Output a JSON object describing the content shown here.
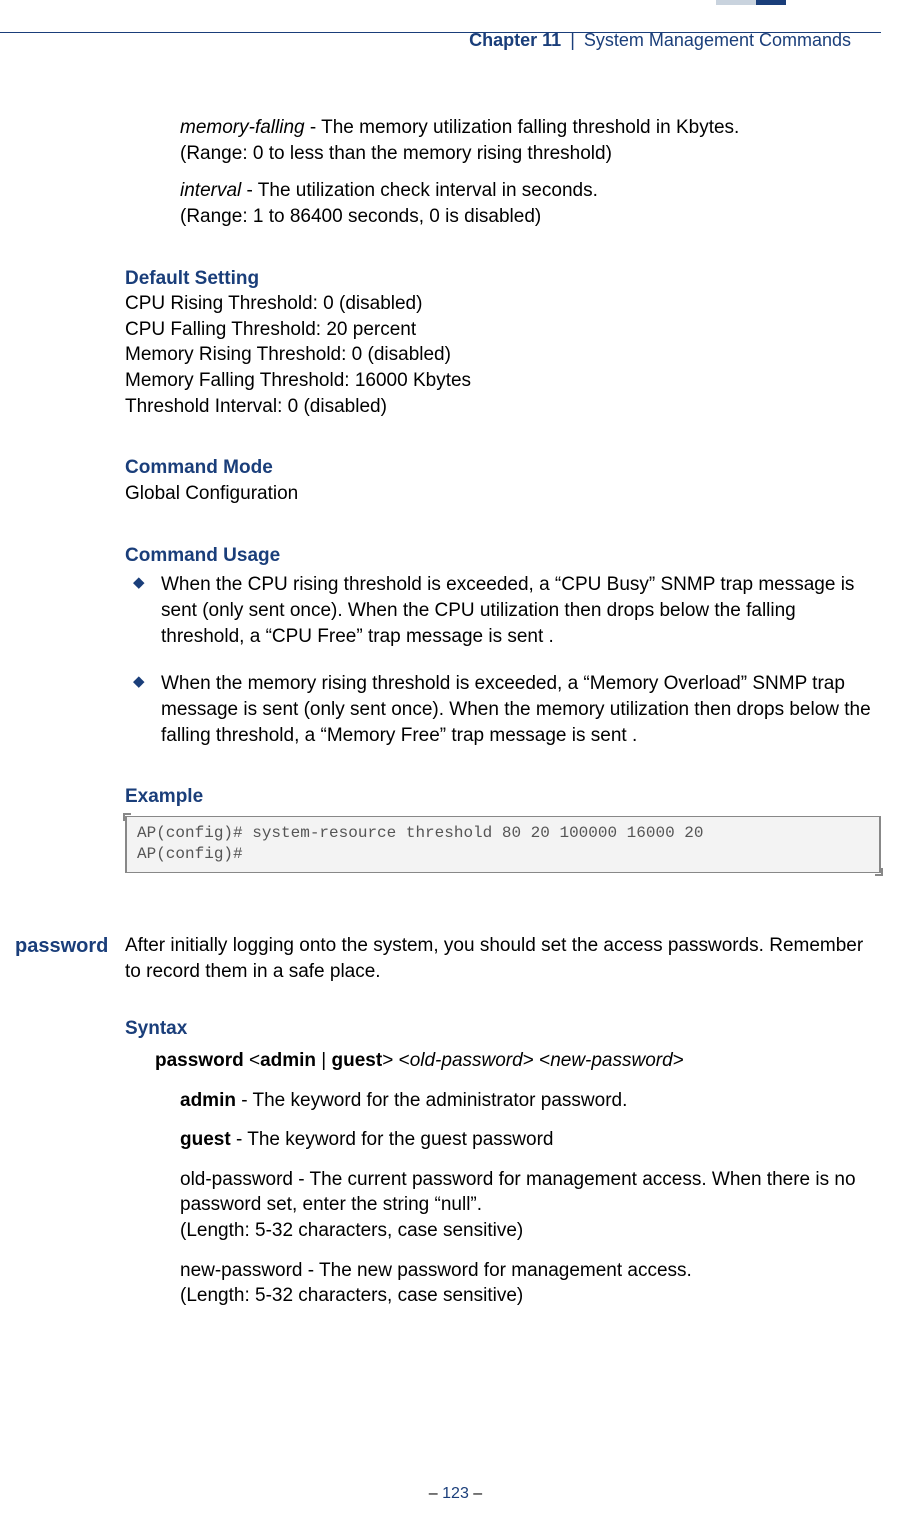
{
  "header": {
    "chapter": "Chapter 11",
    "separator": "|",
    "title": "System Management Commands"
  },
  "params": {
    "memory_falling": {
      "name": "memory-falling",
      "desc": " - The memory utilization falling threshold in Kbytes.",
      "range": "(Range: 0 to less than the memory rising threshold)"
    },
    "interval": {
      "name": "interval",
      "desc": " - The utilization check interval in seconds.",
      "range": "(Range: 1 to 86400 seconds, 0 is disabled)"
    }
  },
  "default_setting": {
    "heading": "Default Setting",
    "lines": [
      "CPU Rising Threshold: 0 (disabled)",
      "CPU Falling Threshold: 20 percent",
      "Memory Rising Threshold: 0 (disabled)",
      "Memory Falling Threshold: 16000 Kbytes",
      "Threshold Interval: 0 (disabled)"
    ]
  },
  "command_mode": {
    "heading": "Command Mode",
    "text": "Global Configuration"
  },
  "command_usage": {
    "heading": "Command Usage",
    "items": [
      "When the CPU rising threshold is exceeded, a “CPU Busy” SNMP trap message is sent (only sent once). When the CPU utilization then drops below the falling threshold, a “CPU Free” trap message is sent .",
      "When the memory rising threshold is exceeded, a “Memory Overload” SNMP trap message is sent (only sent once). When the memory utilization then drops below the falling threshold, a “Memory Free” trap message is sent ."
    ]
  },
  "example": {
    "heading": "Example",
    "code": "AP(config)# system-resource threshold 80 20 100000 16000 20\nAP(config)#"
  },
  "password": {
    "key": "password",
    "intro": "After initially logging onto the system, you should set the access passwords. Remember to record them in a safe place.",
    "syntax_heading": "Syntax",
    "syntax": {
      "cmd": "password",
      "lt1": " <",
      "opt1": "admin",
      "pipe": " | ",
      "opt2": "guest",
      "gt1": "> <",
      "arg1": "old-password",
      "mid": "> <",
      "arg2": "new-password",
      "end": ">"
    },
    "admin": {
      "kw": "admin",
      "desc": " - The keyword for the administrator password."
    },
    "guest": {
      "kw": "guest",
      "desc": " - The keyword for the guest password"
    },
    "oldpw": {
      "line1": "old-password - The current password for management access. When there is no password set, enter the string “null”.",
      "line2": "(Length: 5-32 characters, case sensitive)"
    },
    "newpw": {
      "line1": "new-password - The new password for management access.",
      "line2": "(Length: 5-32 characters, case sensitive)"
    }
  },
  "footer": {
    "dash1": "–  ",
    "page": "123",
    "dash2": "  –"
  }
}
